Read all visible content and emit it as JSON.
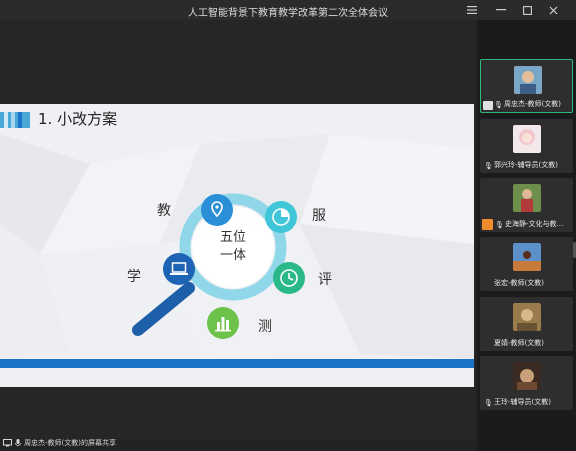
{
  "window": {
    "title": "人工智能背景下教育教学改革第二次全体会议"
  },
  "slide": {
    "title": "1. 小改方案",
    "center_line1": "五位",
    "center_line2": "一体",
    "labels": {
      "jiao": "教",
      "fu": "服",
      "xue": "学",
      "ping": "评",
      "ce": "测"
    }
  },
  "share_status": "周忠杰-教师(文教)的屏幕共享",
  "participants": [
    {
      "name": "周忠杰-教师(文教)",
      "active": true
    },
    {
      "name": "郭兴玲-辅导员(文教)",
      "active": false
    },
    {
      "name": "史海静-文化与教...",
      "active": false
    },
    {
      "name": "张宏-教师(文教)",
      "active": false
    },
    {
      "name": "夏婧-教师(文教)",
      "active": false
    },
    {
      "name": "王玲-辅导员(文教)",
      "active": false
    }
  ],
  "colors": {
    "accent_green": "#2fb67a",
    "slide_blue": "#1d72c9",
    "circle_cyan": "#66c9e0",
    "orange_share": "#f08c2c"
  },
  "icons": {
    "jiao": "location-pin-icon",
    "fu": "pie-chart-icon",
    "xue": "laptop-icon",
    "ping": "clock-icon",
    "ce": "bar-chart-icon"
  }
}
